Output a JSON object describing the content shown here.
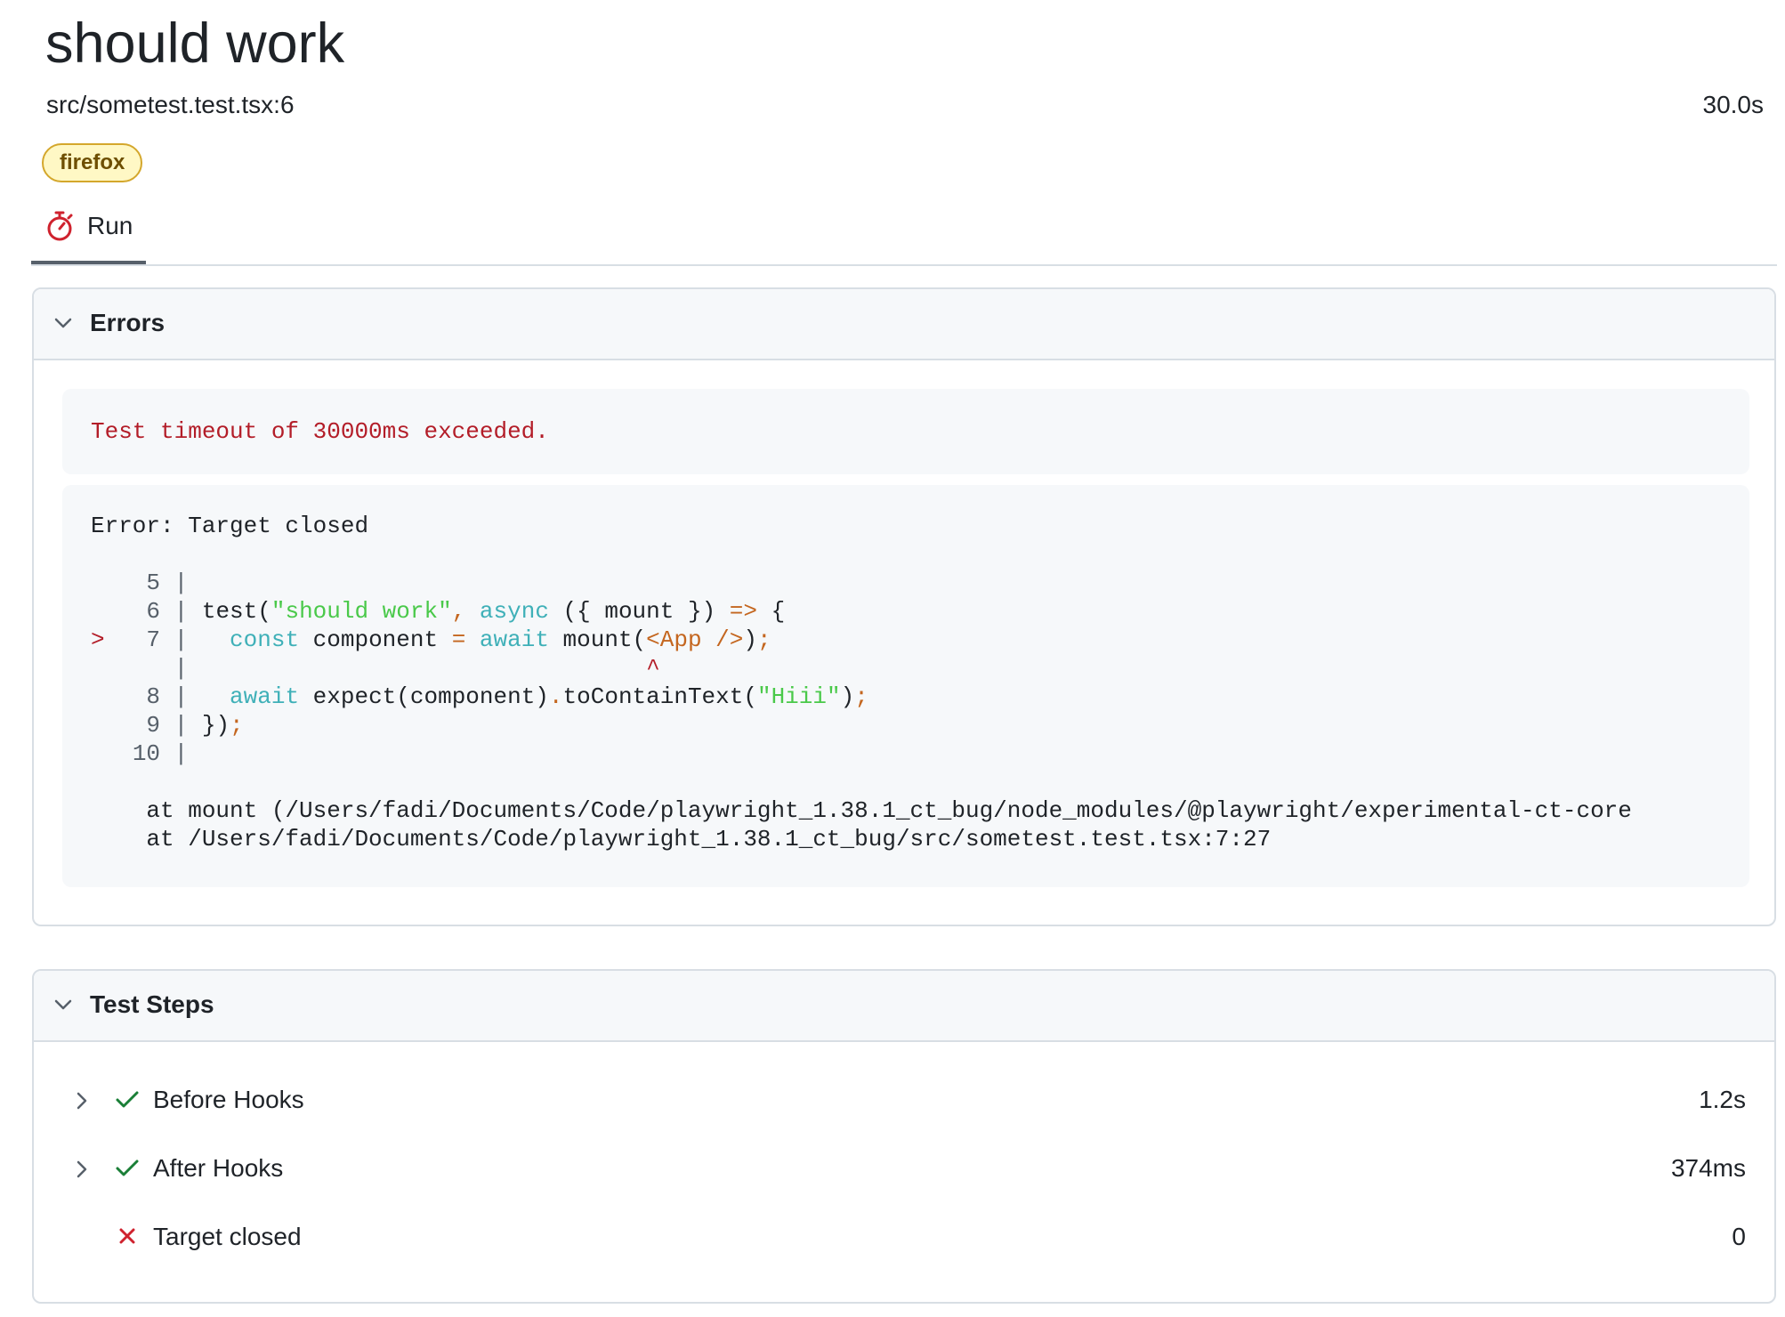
{
  "test": {
    "title": "should work",
    "location": "src/sometest.test.tsx:6",
    "duration": "30.0s",
    "project_badge": "firefox"
  },
  "tabs": [
    {
      "label": "Run",
      "icon": "stopwatch-icon",
      "selected": true
    }
  ],
  "errors": {
    "header": "Errors",
    "timeout_message": "Test timeout of 30000ms exceeded.",
    "stack": {
      "error_line": "Error: Target closed",
      "code_lines": [
        {
          "num": "5",
          "code": ""
        },
        {
          "num": "6",
          "code": "test(\"should work\", async ({ mount }) => {"
        },
        {
          "num": "7",
          "code": "  const component = await mount(<App />);",
          "marker": ">"
        },
        {
          "num": "",
          "code": "                                ^"
        },
        {
          "num": "8",
          "code": "  await expect(component).toContainText(\"Hiii\");"
        },
        {
          "num": "9",
          "code": "});"
        },
        {
          "num": "10",
          "code": ""
        }
      ],
      "trace": [
        "at mount (/Users/fadi/Documents/Code/playwright_1.38.1_ct_bug/node_modules/@playwright/experimental-ct-core",
        "at /Users/fadi/Documents/Code/playwright_1.38.1_ct_bug/src/sometest.test.tsx:7:27"
      ]
    }
  },
  "test_steps": {
    "header": "Test Steps",
    "items": [
      {
        "label": "Before Hooks",
        "duration": "1.2s",
        "status": "passed",
        "expandable": true
      },
      {
        "label": "After Hooks",
        "duration": "374ms",
        "status": "passed",
        "expandable": true
      },
      {
        "label": "Target closed",
        "duration": "0",
        "status": "failed",
        "expandable": false
      }
    ]
  },
  "colors": {
    "error_red": "#b31d28",
    "pass_green": "#1a7f37",
    "badge_bg": "#fff8c5",
    "badge_border": "#d4a72c"
  }
}
